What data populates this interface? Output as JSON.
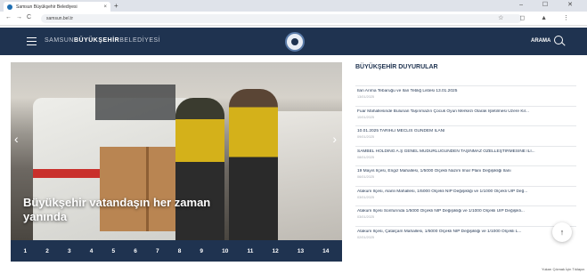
{
  "browser": {
    "tab_title": "Samsun Büyükşehir Belediyesi",
    "tab_close": "×",
    "new_tab": "+",
    "window_controls": "– ☐ ✕",
    "back": "←",
    "forward": "→",
    "reload": "C",
    "url": "samsun.bel.tr",
    "right_icons": "☆ ◻ ▲ ⋮"
  },
  "header": {
    "brand_prefix": "SAMSUN",
    "brand_bold": "BÜYÜKŞEHİR",
    "brand_suffix": "BELEDİYESİ",
    "search_label": "ARAMA"
  },
  "slider": {
    "caption": "Büyükşehir vatandaşın her zaman yanında",
    "prev_arrow": "‹",
    "next_arrow": "›",
    "pages": [
      "1",
      "2",
      "3",
      "4",
      "5",
      "6",
      "7",
      "8",
      "9",
      "10",
      "11",
      "12",
      "13",
      "14"
    ]
  },
  "news": {
    "title": "BÜYÜKŞEHİR DUYURULAR",
    "items": [
      {
        "title": "İlan Arıma Tebaruğu ve İlan Tebliğ Listesi 13.01.2025",
        "date": "13/01/2025"
      },
      {
        "title": "Fuar Mahallesinde Bulunan Taşınmazın Çocuk Oyun Merkezi Olarak İşletilmesi Üzere Kir...",
        "date": "10/01/2025"
      },
      {
        "title": "10.01.2025 TARİHLİ MECLİS GÜNDEM İLANI",
        "date": "09/01/2025"
      },
      {
        "title": "SAMBEL HOLDİNG A.Ş GENEL MÜDÜRLÜĞÜNDEN TAŞINMAZ ÖZELLEŞTİRMESİNE İLİ...",
        "date": "08/01/2025"
      },
      {
        "title": "19 Mayıs İlçesi, Engiz Mahallesi, 1/5000 Ölçekli Nazım İmar Planı Değişikliği İlanı",
        "date": "06/01/2025"
      },
      {
        "title": "Atakum İlçesi, Alanlı Mahallesi, 1/5000 Ölçekli NİP Değişikliği ve 1/1000 Ölçekli UİP Değ...",
        "date": "03/01/2025"
      },
      {
        "title": "Atakum İlçesi Sonfurında 1/5000 Ölçekli NİP Değişikliği ve 1/1000 Ölçekli UİP Değişikli...",
        "date": "03/01/2025"
      },
      {
        "title": "Atakum İlçesi, Çatalçam Mahallesi, 1/5000 Ölçekli NİP Değişikliği ve 1/1000 Ölçekli L...",
        "date": "02/01/2025"
      }
    ]
  },
  "scroll_top": {
    "icon": "↑",
    "label": "Yukarı Çıkmak İçin Tıklayın"
  }
}
